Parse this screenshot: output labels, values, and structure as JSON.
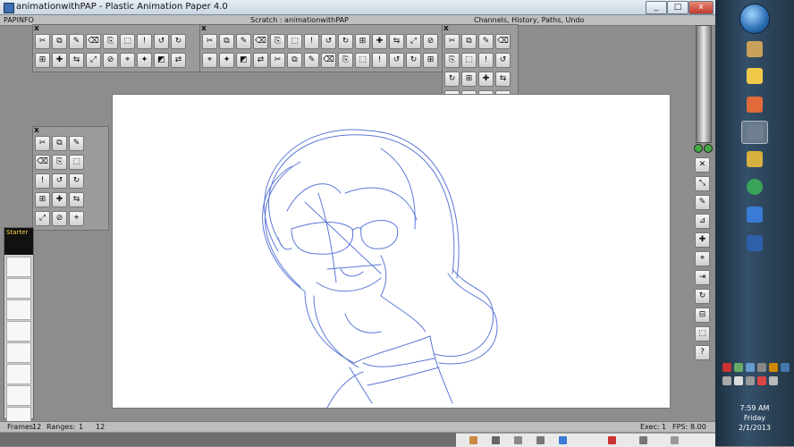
{
  "window": {
    "title": "animationwithPAP - Plastic Animation Paper 4.0",
    "min_label": "_",
    "max_label": "□",
    "close_label": "x"
  },
  "menubar": {
    "left_label": "PAPINFO",
    "scene_label": "Scratch : animationwithPAP",
    "right_label": "Channels, History, Paths, Undo"
  },
  "panels": {
    "close_glyph": "x"
  },
  "status": {
    "frames_label": "Frames:",
    "frames_value": "12",
    "ranges_label": "Ranges:",
    "range_start": "1",
    "range_end": "12",
    "exec_label": "Exec:",
    "exec_value": "1",
    "fps_label": "FPS:",
    "fps_value": "8.00"
  },
  "xsheet": {
    "header_label": "Starter"
  },
  "tray": {
    "time": "7:59 AM",
    "day": "Friday",
    "date": "2/1/2013"
  },
  "icons": {
    "start": "windows-start-orb-icon",
    "taskbar": [
      "explorer-icon",
      "folder-icon",
      "paint-icon",
      "pap-icon",
      "pencil-icon",
      "chrome-icon",
      "thunderbird-icon",
      "word-icon"
    ]
  },
  "colors": {
    "sketch_stroke": "#5c79d6",
    "canvas": "#ffffff",
    "app_bg": "#8d8d8d"
  }
}
